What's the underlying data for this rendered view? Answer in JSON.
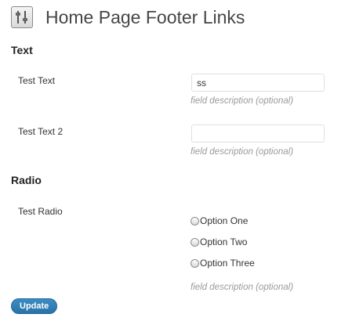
{
  "header": {
    "icon": "settings-sliders-icon",
    "title": "Home Page Footer Links"
  },
  "sections": {
    "text": {
      "title": "Text",
      "fields": [
        {
          "label": "Test Text",
          "value": "ss",
          "description": "field description (optional)"
        },
        {
          "label": "Test Text 2",
          "value": "",
          "description": "field description (optional)"
        }
      ]
    },
    "radio": {
      "title": "Radio",
      "label": "Test Radio",
      "options": [
        "Option One",
        "Option Two",
        "Option Three"
      ],
      "selected": null,
      "description": "field description (optional)"
    }
  },
  "actions": {
    "update_label": "Update",
    "update_color": "#2a73a8"
  }
}
